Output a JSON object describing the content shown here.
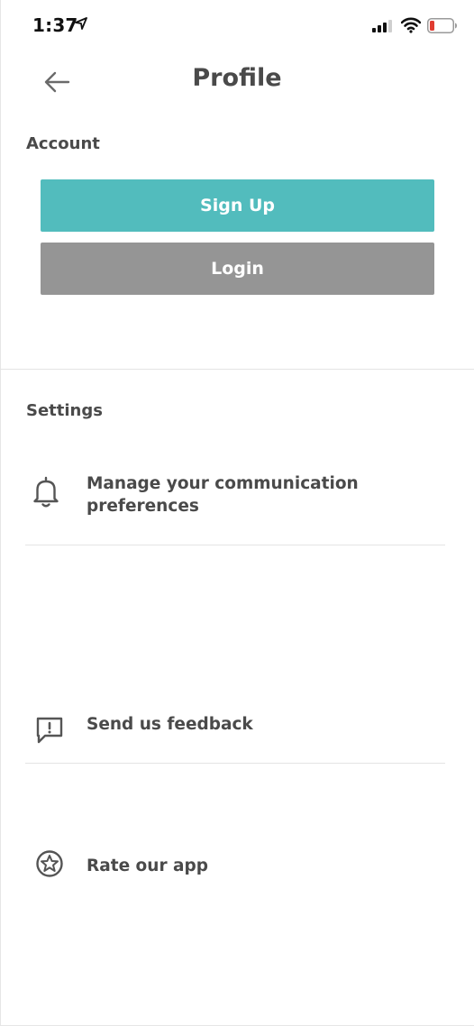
{
  "status_bar": {
    "time": "1:37"
  },
  "header": {
    "title": "Profile"
  },
  "account": {
    "heading": "Account",
    "signup_label": "Sign Up",
    "login_label": "Login"
  },
  "settings": {
    "heading": "Settings",
    "items": [
      {
        "icon": "bell-icon",
        "label_line1": "Manage your communication",
        "label_line2": "preferences"
      },
      {
        "icon": "feedback-icon",
        "label": "Send us feedback"
      },
      {
        "icon": "star-icon",
        "label": "Rate our app"
      }
    ]
  },
  "colors": {
    "signup": "#52bcbd",
    "login": "#959595",
    "battery_low": "#e03c31"
  }
}
